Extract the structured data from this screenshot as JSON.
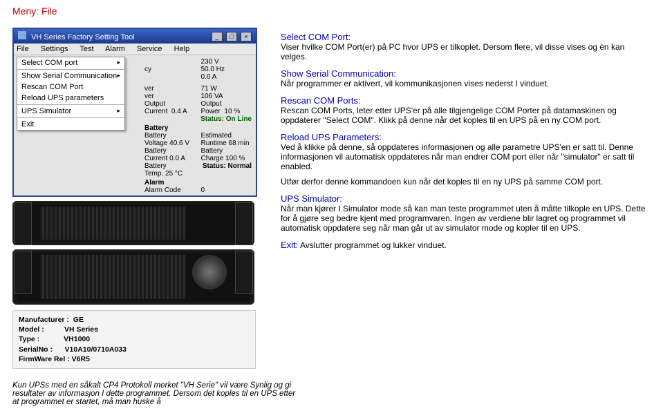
{
  "page": {
    "red_title": "Meny: File"
  },
  "sections": {
    "sel": {
      "head": "Select COM Port:",
      "body": "Viser hvilke COM Port(er) på PC hvor UPS er tilkoplet. Dersom flere, vil disse vises og èn kan velges."
    },
    "show": {
      "head": "Show Serial Communication:",
      "body": "Når programmer er aktivert, vil kommunikasjonen vises nederst I vinduet."
    },
    "rescan": {
      "head": "Rescan COM Ports:",
      "body": "Rescan COM Ports, leter etter UPS'er på alle tilgjengelige COM Porter på datamaskinen og oppdaterer \"Select COM\". Klikk på denne når det koples til en UPS på en ny COM port."
    },
    "reload": {
      "head": "Reload UPS Parameters:",
      "body": "Ved å klikke på denne, så oppdateres informasjonen og alle parametre UPS'en er satt til. Denne informasjonen vil automatisk oppdateres når man endrer COM port eller når \"simulator\" er satt til enabled.",
      "body2": "Utfør derfor denne kommandoen kun når det koples til en ny UPS på samme COM port."
    },
    "sim": {
      "head": "UPS Simulator:",
      "body": "Når man kjører I Simulator mode så kan man teste programmet uten å måtte tilkople en UPS. Dette for å gjøre seg bedre kjent med programvaren. Ingen av verdiene blir lagret og programmet vil automatisk oppdatere seg når man går ut av simulator mode og kopler til en UPS."
    },
    "exit": {
      "head": "Exit:",
      "body": " Avslutter programmet og lukker vinduet."
    }
  },
  "footer": {
    "note": "Kun UPSs med en såkalt CP4 Protokoll merket \"VH Serie\" vil være Synlig og gi resultater av informasjon I dette programmet. Dersom det koples til en UPS etter at programmet er startet, må man huske å"
  },
  "app": {
    "title": "VH Series Factory Setting Tool",
    "menubar": {
      "file": "File",
      "settings": "Settings",
      "test": "Test",
      "alarm": "Alarm",
      "service": "Service",
      "help": "Help"
    },
    "filemenu": {
      "select": "Select COM port",
      "show": "Show Serial Communication",
      "rescan": "Rescan COM Port",
      "reload": "Reload UPS parameters",
      "sim": "UPS Simulator",
      "exit": "Exit"
    },
    "grid": {
      "v": "230 V",
      "hz": "50.0 Hz",
      "a": "0.0 A",
      "powerw": "71 W",
      "powerva": "106 VA",
      "pct": "10 %",
      "outcurlab": "Output Current",
      "outcur": "0.4 A",
      "outpowlab": "Output Power",
      "statusline": "Status: On Line",
      "battlabel": "Battery",
      "bvlab": "Battery Voltage",
      "bv": "40.6 V",
      "ertlab": "Estimated Runtime",
      "ert": "68 min",
      "bclab": "Battery Current",
      "bc": "0.0 A",
      "bchlab": "Battery Charge",
      "bch": "100 %",
      "btlab": "Battery Temp.",
      "bt": "25 °C",
      "statusnorm": "Status: Normal",
      "alarmlab": "Alarm",
      "alarmcode": "Alarm Code",
      "alarmv": "0"
    },
    "info": {
      "manulab": "Manufacturer :",
      "manu": "GE",
      "modellab": "Model :",
      "model": "VH Series",
      "typelab": "Type :",
      "type": "VH1000",
      "serlab": "SerialNo :",
      "ser": "V10A10/0710A033",
      "fwlab": "FirmWare Rel :",
      "fw": "V6R5"
    }
  }
}
